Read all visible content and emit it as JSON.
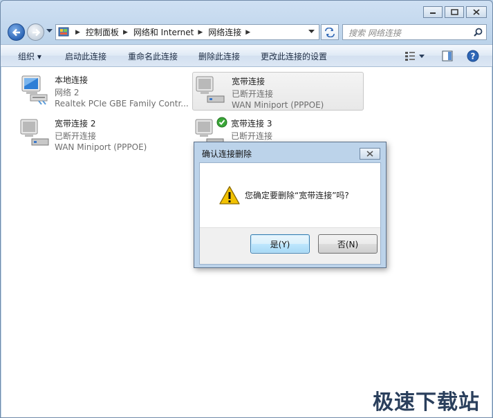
{
  "address": {
    "crumbs": [
      {
        "label": "控制面板"
      },
      {
        "label": "网络和 Internet"
      },
      {
        "label": "网络连接"
      }
    ]
  },
  "search": {
    "placeholder": "搜索 网络连接"
  },
  "toolbar": {
    "organize": "组织 ▾",
    "enable": "启动此连接",
    "rename": "重命名此连接",
    "delete": "删除此连接",
    "change_settings": "更改此连接的设置"
  },
  "connections": [
    {
      "name": "本地连接",
      "status": "网络  2",
      "device": "Realtek PCIe GBE Family Contr..."
    },
    {
      "name": "宽带连接",
      "status": "已断开连接",
      "device": "WAN Miniport (PPPOE)"
    },
    {
      "name": "宽带连接 2",
      "status": "已断开连接",
      "device": "WAN Miniport (PPPOE)"
    },
    {
      "name": "宽带连接 3",
      "status": "已断开连接",
      "device": ""
    }
  ],
  "dialog": {
    "title": "确认连接删除",
    "message": "您确定要删除“宽带连接”吗?",
    "yes": "是(Y)",
    "no": "否(N)"
  },
  "watermark": "极速下载站",
  "colors": {
    "accent": "#2d66b6",
    "chrome": "#bcd3ea",
    "check_green": "#3aa638",
    "warning": "#f2c200"
  }
}
